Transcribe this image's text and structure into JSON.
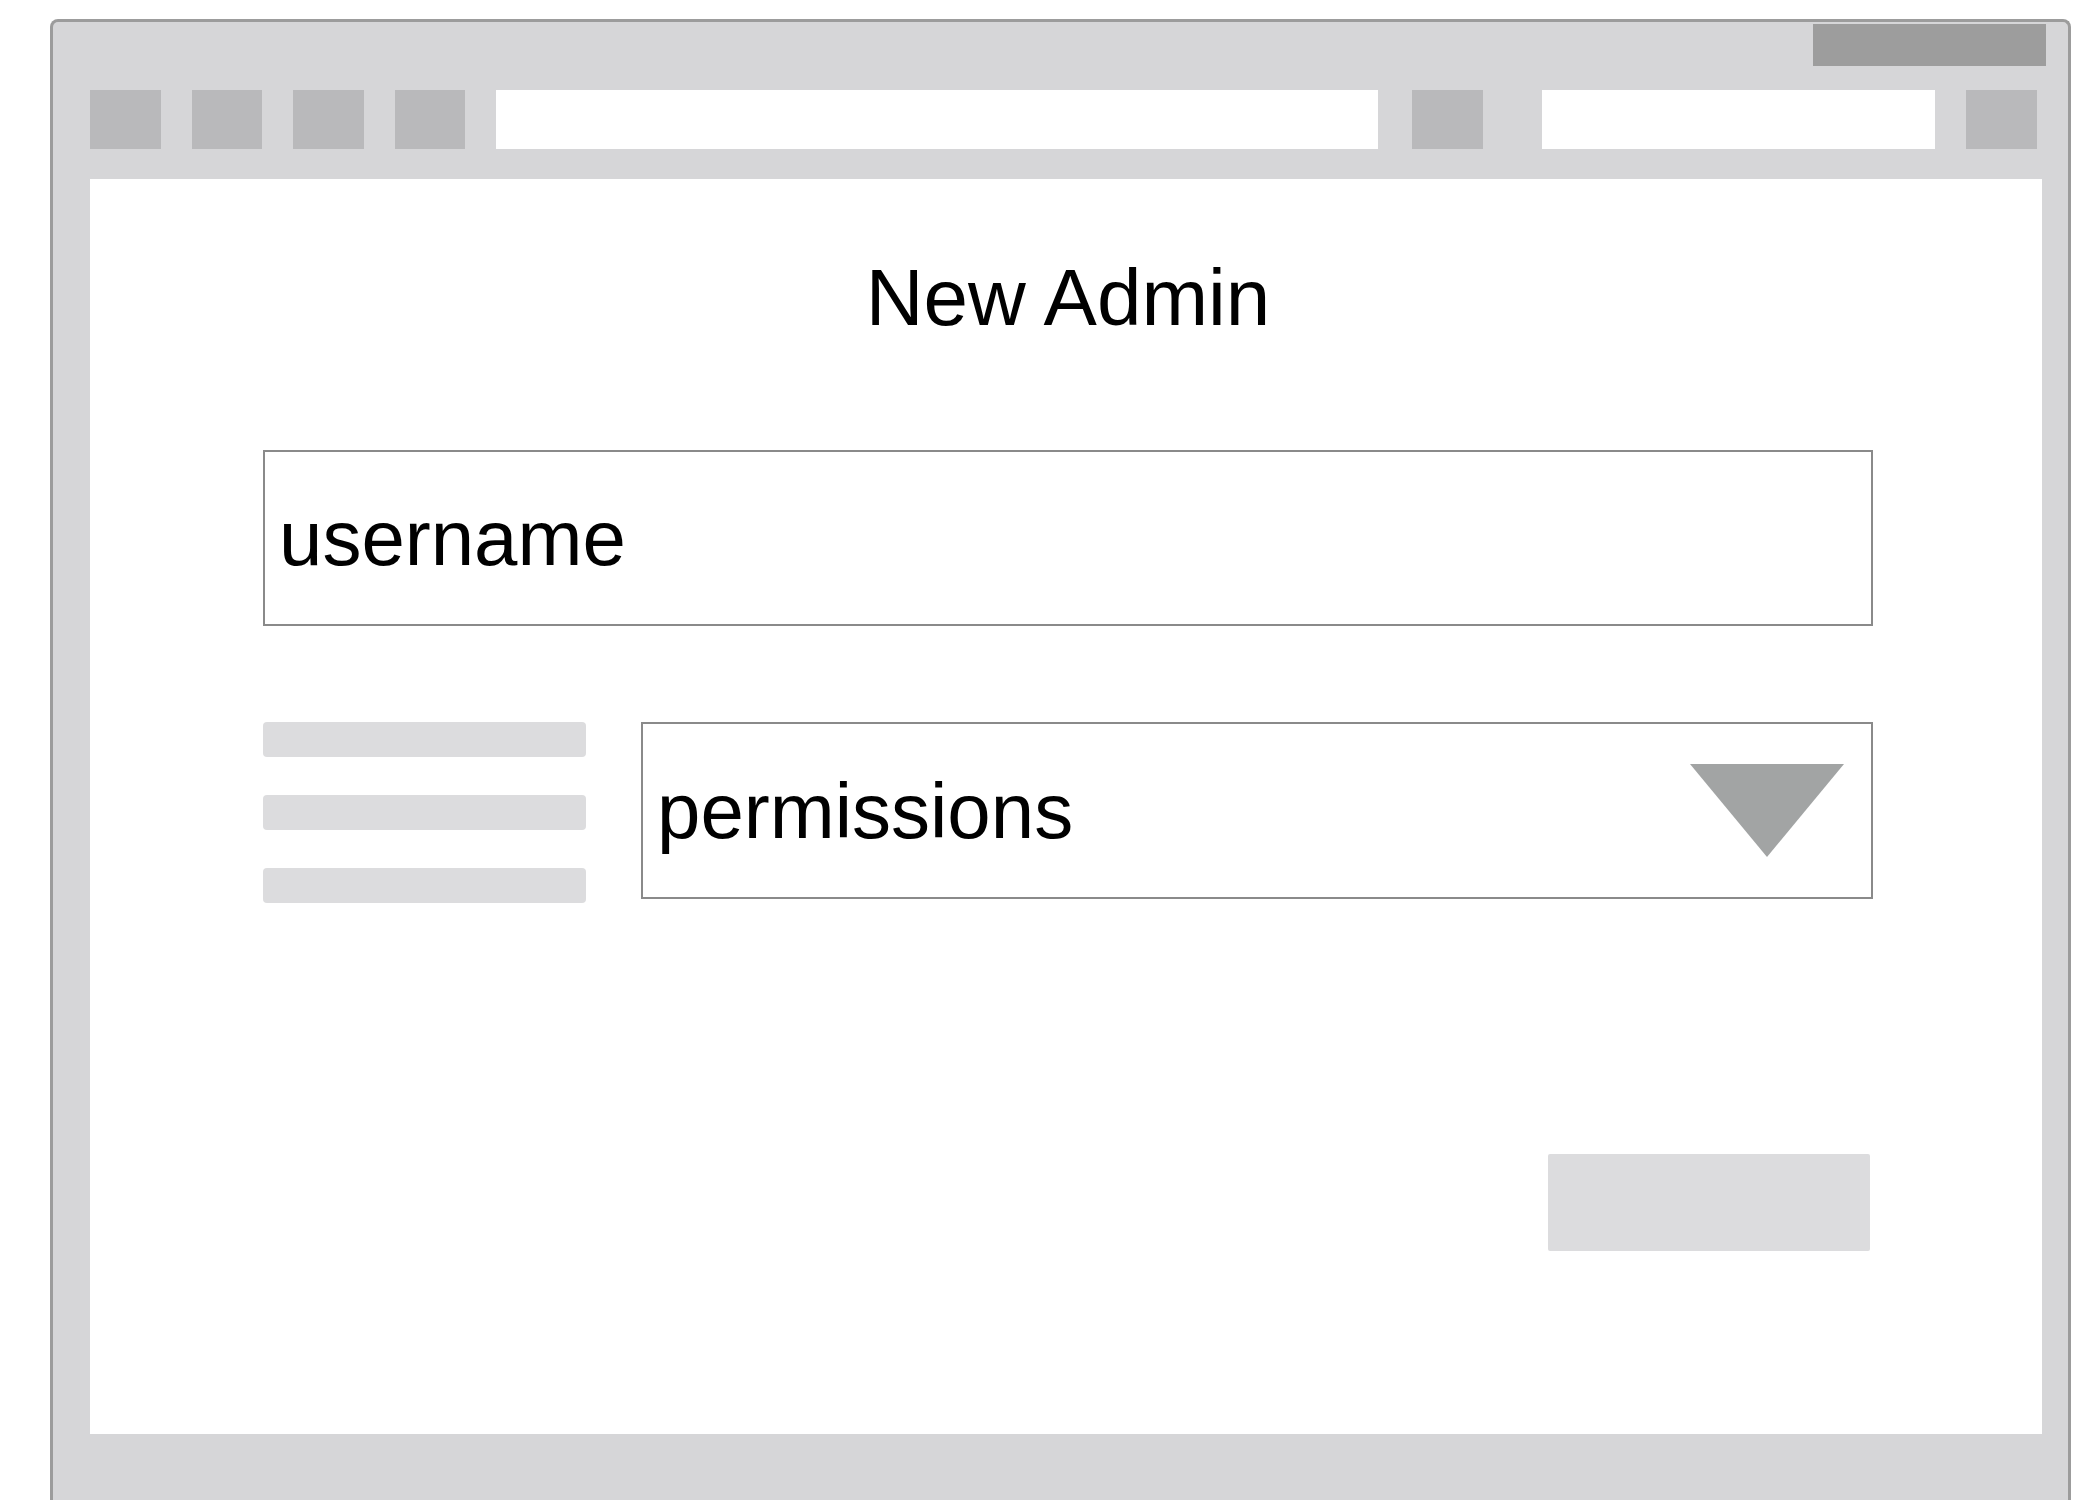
{
  "title": "New Admin",
  "username_field": {
    "placeholder": "username"
  },
  "permissions_dropdown": {
    "value": "permissions"
  }
}
